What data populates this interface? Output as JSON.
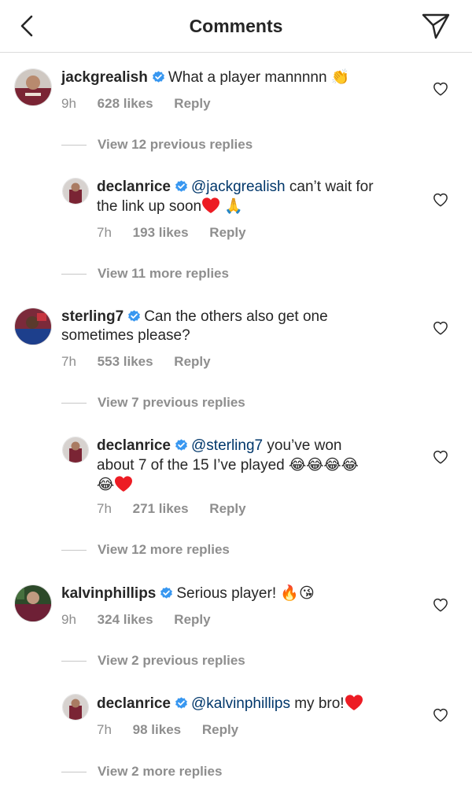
{
  "header": {
    "title": "Comments"
  },
  "colors": {
    "mention": "#00376b",
    "verified": "#3897f0",
    "heart_red": "#ed1c24",
    "muted": "#8e8e8e"
  },
  "comments": [
    {
      "username": "jackgrealish",
      "text": "What a player mannnnn",
      "emoji": "👏",
      "time": "9h",
      "likes": "628 likes",
      "reply": "Reply",
      "view_replies": "View 12 previous replies",
      "reply_item": {
        "username": "declanrice",
        "mention": "@jackgrealish",
        "text_line1_rest": "can’t wait for",
        "text_line2": "the link up soon",
        "emoji": "🙏",
        "time": "7h",
        "likes": "193 likes",
        "reply": "Reply"
      },
      "view_more": "View 11 more replies"
    },
    {
      "username": "sterling7",
      "text_line1": "Can the others also get one",
      "text_line2": "sometimes please?",
      "time": "7h",
      "likes": "553 likes",
      "reply": "Reply",
      "view_replies": "View 7 previous replies",
      "reply_item": {
        "username": "declanrice",
        "mention": "@sterling7",
        "text_line1_rest": "you’ve won",
        "text_line2": "about 7 of the 15 I’ve played",
        "emoji_line2": "😂😂😂😂",
        "emoji_line3": "😂",
        "time": "7h",
        "likes": "271 likes",
        "reply": "Reply"
      },
      "view_more": "View 12 more replies"
    },
    {
      "username": "kalvinphillips",
      "text": "Serious player!",
      "emoji": "🔥😘",
      "time": "9h",
      "likes": "324 likes",
      "reply": "Reply",
      "view_replies": "View 2 previous replies",
      "reply_item": {
        "username": "declanrice",
        "mention": "@kalvinphillips",
        "text_rest": "my bro!",
        "time": "7h",
        "likes": "98 likes",
        "reply": "Reply"
      },
      "view_more": "View 2 more replies"
    }
  ]
}
